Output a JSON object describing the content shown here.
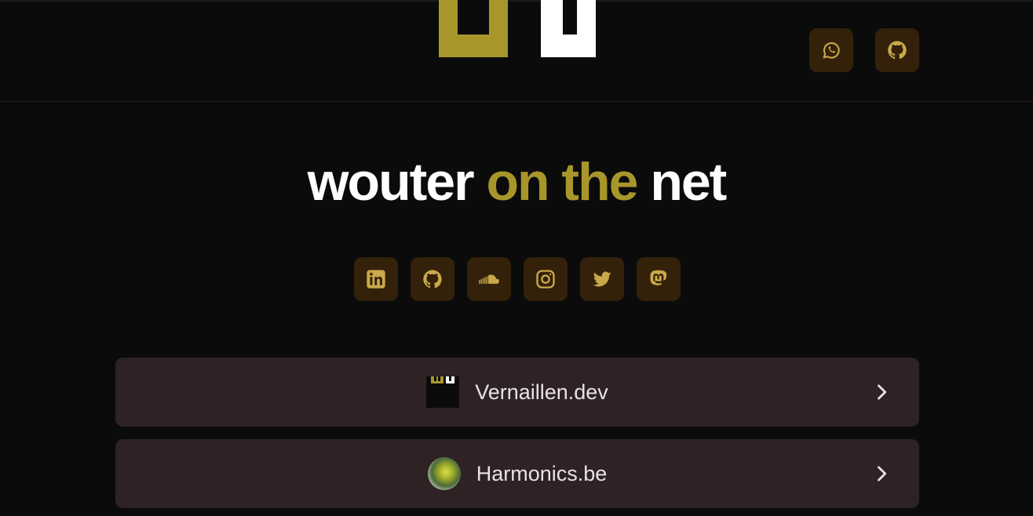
{
  "header": {
    "logo_alt": "WV logo",
    "icons": [
      {
        "name": "whatsapp-icon"
      },
      {
        "name": "github-icon"
      }
    ]
  },
  "hero": {
    "title_part1": "wouter ",
    "title_accent": "on the",
    "title_part2": " net"
  },
  "socials": [
    {
      "name": "linkedin-icon"
    },
    {
      "name": "github-icon"
    },
    {
      "name": "soundcloud-icon"
    },
    {
      "name": "instagram-icon"
    },
    {
      "name": "twitter-icon"
    },
    {
      "name": "mastodon-icon"
    }
  ],
  "links": [
    {
      "label": "Vernaillen.dev",
      "thumb": "vernaillen-logo"
    },
    {
      "label": "Harmonics.be",
      "thumb": "harmonics-orb"
    }
  ],
  "colors": {
    "accent": "#a8962a",
    "icon_bg": "#34210a",
    "icon_fg": "#c9a94a",
    "card_bg": "#2e2224",
    "background": "#0b0b0c"
  }
}
